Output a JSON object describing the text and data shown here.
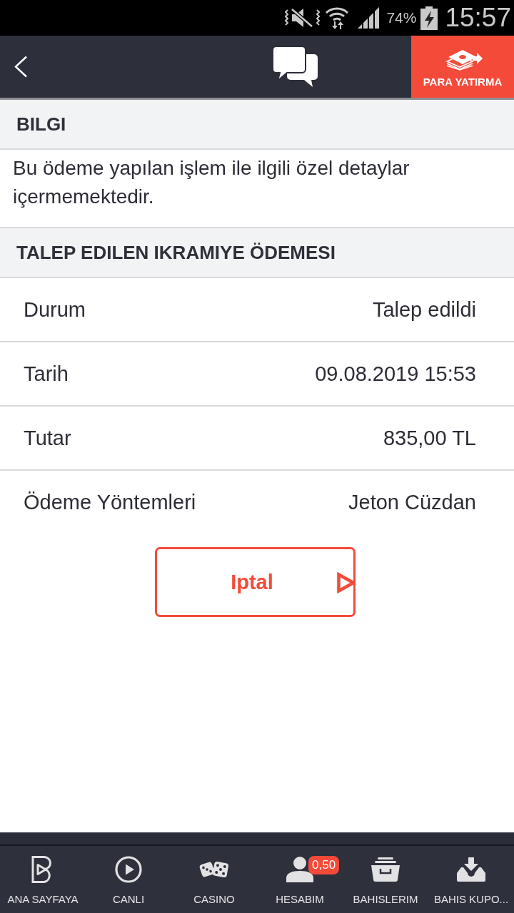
{
  "status_bar": {
    "battery": "74%",
    "time": "15:57"
  },
  "header": {
    "deposit_button": "PARA YATIRMA"
  },
  "info": {
    "title": "BILGI",
    "text": "Bu ödeme yapılan işlem ile ilgili özel detaylar içermemektedir."
  },
  "payment": {
    "title": "TALEP EDILEN IKRAMIYE ÖDEMESI",
    "rows": [
      {
        "label": "Durum",
        "value": "Talep edildi"
      },
      {
        "label": "Tarih",
        "value": "09.08.2019 15:53"
      },
      {
        "label": "Tutar",
        "value": "835,00 TL"
      },
      {
        "label": "Ödeme Yöntemleri",
        "value": "Jeton Cüzdan"
      }
    ]
  },
  "cancel_button": "Iptal",
  "bottom_nav": [
    {
      "label": "ANA SAYFAYA"
    },
    {
      "label": "CANLI"
    },
    {
      "label": "CASINO"
    },
    {
      "label": "HESABIM",
      "badge": "0,50"
    },
    {
      "label": "BAHISLERIM"
    },
    {
      "label": "BAHIS KUPO..."
    }
  ]
}
